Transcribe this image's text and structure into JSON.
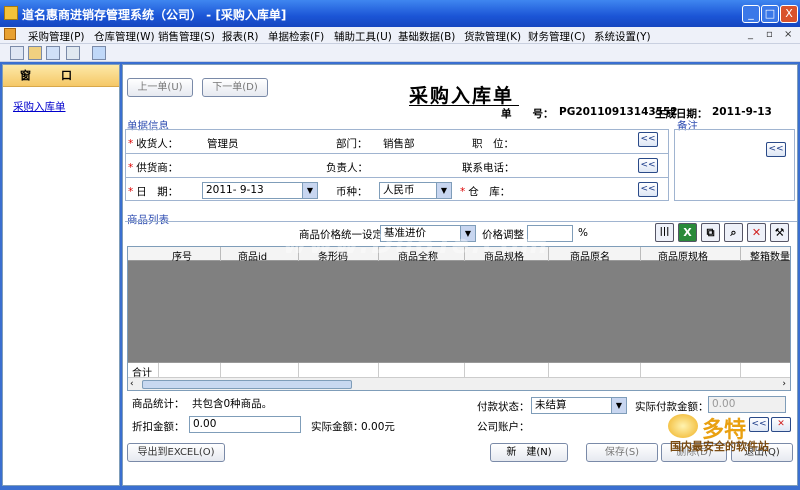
{
  "window": {
    "title": "道名惠商进销存管理系统（公司）  - [采购入库单]",
    "min": "_",
    "max": "□",
    "close": "X"
  },
  "menu": {
    "items": [
      "采购管理(P)",
      "仓库管理(W)",
      "销售管理(S)",
      "报表(R)",
      "单据检索(F)",
      "辅助工具(U)",
      "基础数据(B)",
      "货款管理(K)",
      "财务管理(C)",
      "系统设置(Y)"
    ],
    "right": [
      "_",
      "▫",
      "×"
    ]
  },
  "left": {
    "header": "窗口",
    "link": "采购入库单"
  },
  "nav": {
    "prev": "上一单(U)",
    "next": "下一单(D)"
  },
  "form": {
    "title": "采购入库单",
    "no_label": "单　　号：",
    "no_value": "PG20110913143552",
    "gen_date_label": "生成日期：",
    "gen_date_value": "2011-9-13",
    "sect_info": "单据信息",
    "sect_note": "备注",
    "receiver_label": "收货人：",
    "receiver_value": "管理员",
    "dept_label": "部门：",
    "dept_value": "销售部",
    "position_label": "职　位：",
    "supplier_label": "供货商：",
    "manager_label": "负责人：",
    "phone_label": "联系电话：",
    "date_label": "日　期：",
    "date_value": "2011- 9-13",
    "currency_label": "币种：",
    "currency_value": "人民币",
    "warehouse_label": "仓　库：",
    "pick_btn": "<<"
  },
  "goods": {
    "sect": "商品列表",
    "price_set_label": "商品价格统一设定",
    "price_set_value": "基准进价",
    "price_adj_label": "价格调整",
    "price_adj_value": "",
    "percent": "%",
    "columns": [
      "序号",
      "商品id",
      "条形码",
      "商品全称",
      "商品规格",
      "商品原名",
      "商品原规格",
      "整箱数量"
    ],
    "footer_label": "合计"
  },
  "summary": {
    "count_label": "商品统计：",
    "count_value": "共包含0种商品。",
    "pay_status_label": "付款状态：",
    "pay_status_value": "未结算",
    "actual_pay_label": "实际付款金额：",
    "actual_pay_value": "0.00",
    "discount_label": "折扣金额：",
    "discount_value": "0.00",
    "actual_amount_label": "实际金额：",
    "actual_amount_value": "0.00元",
    "account_label": "公司账户："
  },
  "buttons": {
    "export": "导出到EXCEL(O)",
    "new": "新　建(N)",
    "save": "保存(S)",
    "delete": "删除(D)",
    "exit": "退出(Q)"
  },
  "watermark": "www.DuoTe.com",
  "logo": {
    "big": "多特",
    "sub": "国内最安全的软件站"
  }
}
